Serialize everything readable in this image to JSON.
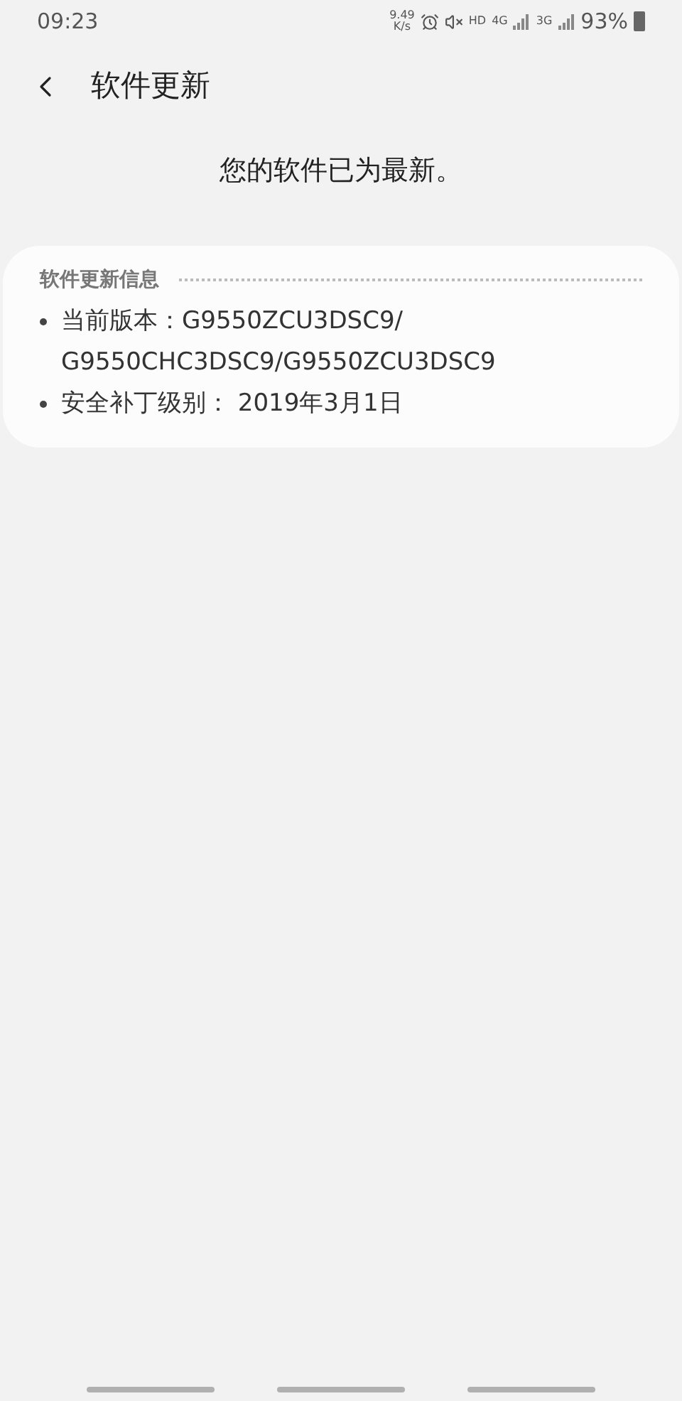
{
  "status_bar": {
    "time": "09:23",
    "net_speed": "9.49",
    "net_unit": "K/s",
    "hd": "HD",
    "network_1": "4G",
    "network_2": "3G",
    "battery": "93%"
  },
  "header": {
    "title": "软件更新"
  },
  "message": "您的软件已为最新。",
  "info_card": {
    "title": "软件更新信息",
    "items": [
      {
        "text": "当前版本：G9550ZCU3DSC9/ G9550CHC3DSC9/G9550ZCU3DSC9"
      },
      {
        "text": "安全补丁级别： 2019年3月1日"
      }
    ]
  }
}
